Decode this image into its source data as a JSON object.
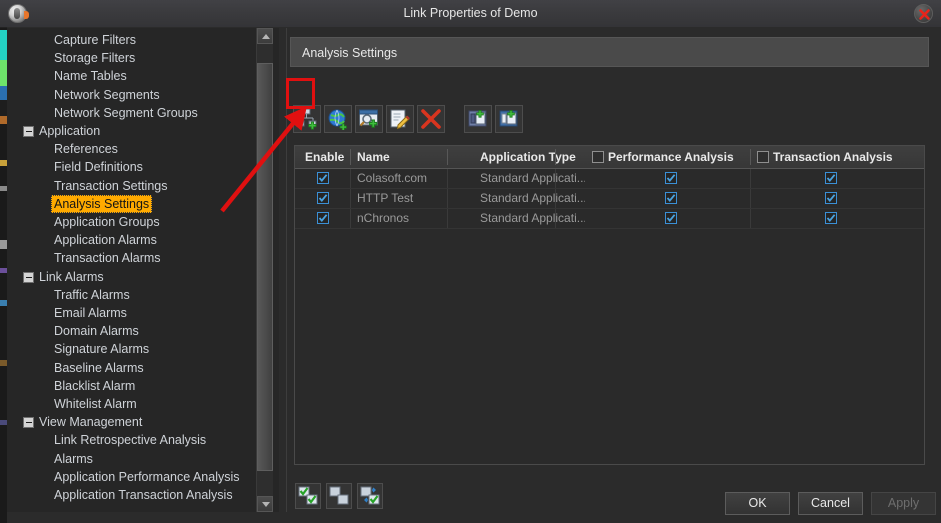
{
  "window": {
    "title": "Link Properties of Demo",
    "app_icon": "clock-icon",
    "close_icon": "close-icon"
  },
  "sidebar": {
    "scrollbar": {
      "up_icon": "scroll-up-arrow-icon",
      "down_icon": "scroll-down-arrow-icon"
    },
    "items": [
      {
        "label": "Capture Filters",
        "level": 1,
        "selected": false,
        "expander": false
      },
      {
        "label": "Storage Filters",
        "level": 1,
        "selected": false,
        "expander": false
      },
      {
        "label": "Name Tables",
        "level": 1,
        "selected": false,
        "expander": false
      },
      {
        "label": "Network Segments",
        "level": 1,
        "selected": false,
        "expander": false
      },
      {
        "label": "Network Segment Groups",
        "level": 1,
        "selected": false,
        "expander": false
      },
      {
        "label": "Application",
        "level": 0,
        "selected": false,
        "expander": true
      },
      {
        "label": "References",
        "level": 1,
        "selected": false,
        "expander": false
      },
      {
        "label": "Field Definitions",
        "level": 1,
        "selected": false,
        "expander": false
      },
      {
        "label": "Transaction Settings",
        "level": 1,
        "selected": false,
        "expander": false
      },
      {
        "label": "Analysis Settings",
        "level": 1,
        "selected": true,
        "expander": false
      },
      {
        "label": "Application Groups",
        "level": 1,
        "selected": false,
        "expander": false
      },
      {
        "label": "Application Alarms",
        "level": 1,
        "selected": false,
        "expander": false
      },
      {
        "label": "Transaction Alarms",
        "level": 1,
        "selected": false,
        "expander": false
      },
      {
        "label": "Link Alarms",
        "level": 0,
        "selected": false,
        "expander": true
      },
      {
        "label": "Traffic Alarms",
        "level": 1,
        "selected": false,
        "expander": false
      },
      {
        "label": "Email Alarms",
        "level": 1,
        "selected": false,
        "expander": false
      },
      {
        "label": "Domain Alarms",
        "level": 1,
        "selected": false,
        "expander": false
      },
      {
        "label": "Signature Alarms",
        "level": 1,
        "selected": false,
        "expander": false
      },
      {
        "label": "Baseline Alarms",
        "level": 1,
        "selected": false,
        "expander": false
      },
      {
        "label": "Blacklist Alarm",
        "level": 1,
        "selected": false,
        "expander": false
      },
      {
        "label": "Whitelist Alarm",
        "level": 1,
        "selected": false,
        "expander": false
      },
      {
        "label": "View Management",
        "level": 0,
        "selected": false,
        "expander": true
      },
      {
        "label": "Link Retrospective Analysis",
        "level": 1,
        "selected": false,
        "expander": false
      },
      {
        "label": "Alarms",
        "level": 1,
        "selected": false,
        "expander": false
      },
      {
        "label": "Application Performance Analysis",
        "level": 1,
        "selected": false,
        "expander": false
      },
      {
        "label": "Application Transaction Analysis",
        "level": 1,
        "selected": false,
        "expander": false
      }
    ]
  },
  "panel": {
    "header": "Analysis Settings"
  },
  "toolbar": {
    "buttons": [
      {
        "name": "add-application-icon",
        "highlighted": true
      },
      {
        "name": "add-web-application-icon",
        "highlighted": false
      },
      {
        "name": "add-signature-application-icon",
        "highlighted": false
      },
      {
        "name": "edit-application-icon",
        "highlighted": false
      },
      {
        "name": "delete-application-icon",
        "highlighted": false
      },
      {
        "name": "import-applications-icon",
        "highlighted": false
      },
      {
        "name": "export-applications-icon",
        "highlighted": false
      }
    ]
  },
  "table": {
    "columns": [
      {
        "label": "Enable",
        "has_checkbox": false,
        "checked": false
      },
      {
        "label": "Name",
        "has_checkbox": false,
        "checked": false
      },
      {
        "label": "Application Type",
        "has_checkbox": false,
        "checked": false
      },
      {
        "label": "Performance Analysis",
        "has_checkbox": true,
        "checked": false
      },
      {
        "label": "Transaction Analysis",
        "has_checkbox": true,
        "checked": false
      }
    ],
    "rows": [
      {
        "enable": true,
        "name": "Colasoft.com",
        "app_type": "Standard Applicati...",
        "performance_analysis": true,
        "transaction_analysis": true
      },
      {
        "enable": true,
        "name": "HTTP Test",
        "app_type": "Standard Applicati...",
        "performance_analysis": true,
        "transaction_analysis": true
      },
      {
        "enable": true,
        "name": "nChronos",
        "app_type": "Standard Applicati...",
        "performance_analysis": true,
        "transaction_analysis": true
      }
    ]
  },
  "bottom_tools": {
    "buttons": [
      {
        "name": "select-all-icon"
      },
      {
        "name": "deselect-all-icon"
      },
      {
        "name": "invert-selection-icon"
      }
    ]
  },
  "footer": {
    "ok": "OK",
    "cancel": "Cancel",
    "apply": "Apply",
    "apply_disabled": true
  },
  "annotation": {
    "highlight_color": "#e01010",
    "shape": "arrow-pointing-to-add-application-button"
  },
  "colors": {
    "selection": "#ffaa00",
    "checkbox_border": "#3b90d6",
    "titlebar": "#3a3a3d",
    "content_bg": "#2a2a2a"
  }
}
